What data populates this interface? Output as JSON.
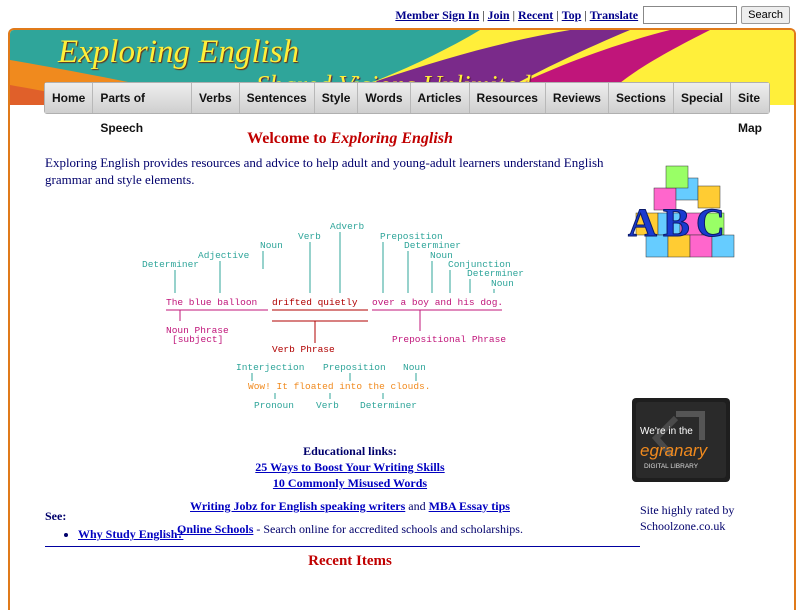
{
  "topbar": {
    "links": [
      "Member Sign In",
      "Join",
      "Recent",
      "Top",
      "Translate"
    ],
    "search_value": "",
    "search_button": "Search"
  },
  "banner": {
    "title": "Exploring English",
    "subtitle": "Shared Visions Unlimited"
  },
  "nav": [
    "Home",
    "Parts of Speech",
    "Verbs",
    "Sentences",
    "Style",
    "Words",
    "Articles",
    "Resources",
    "Reviews",
    "Sections",
    "Special",
    "Site Map"
  ],
  "welcome": {
    "prefix": "Welcome to ",
    "site": "Exploring English"
  },
  "intro": "Exploring English provides resources and advice to help adult and young-adult learners understand English grammar and style elements.",
  "diagram": {
    "sentence1_a": "The blue balloon",
    "sentence1_b": "drifted quietly",
    "sentence1_c": "over a boy and his dog.",
    "labels_top": [
      "Determiner",
      "Adjective",
      "Noun",
      "Verb",
      "Adverb",
      "Preposition",
      "Determiner",
      "Noun",
      "Conjunction",
      "Determiner",
      "Noun"
    ],
    "noun_phrase": "Noun Phrase",
    "subject": "[subject]",
    "verb_phrase": "Verb Phrase",
    "prep_phrase": "Prepositional Phrase",
    "labels_mid": [
      "Interjection",
      "Preposition",
      "Noun"
    ],
    "sentence2": "Wow! It floated into the clouds.",
    "labels_bottom": [
      "Pronoun",
      "Verb",
      "Determiner"
    ]
  },
  "abc_letters": [
    "A",
    "B",
    "C"
  ],
  "educational": {
    "heading": "Educational links:",
    "link1": "25 Ways to Boost Your Writing Skills",
    "link2": "10 Commonly Misused Words",
    "link3": "Writing Jobz for English speaking writers",
    "and": " and ",
    "link4": "MBA Essay tips",
    "link5": "Online Schools",
    "link5_text": " - Search online for accredited schools and scholarships."
  },
  "egranary": {
    "line1": "We're in the",
    "line2": "egranary",
    "line3": "DIGITAL LIBRARY"
  },
  "rated": "Site highly rated by Schoolzone.co.uk",
  "see": "See:",
  "why": "Why Study English?",
  "recent": "Recent Items",
  "colors": {
    "frame": "#e07a1a",
    "teal": "#2fa59a",
    "magenta": "#c0157a",
    "yellow": "#ffef3a",
    "orange": "#f08a1e"
  }
}
